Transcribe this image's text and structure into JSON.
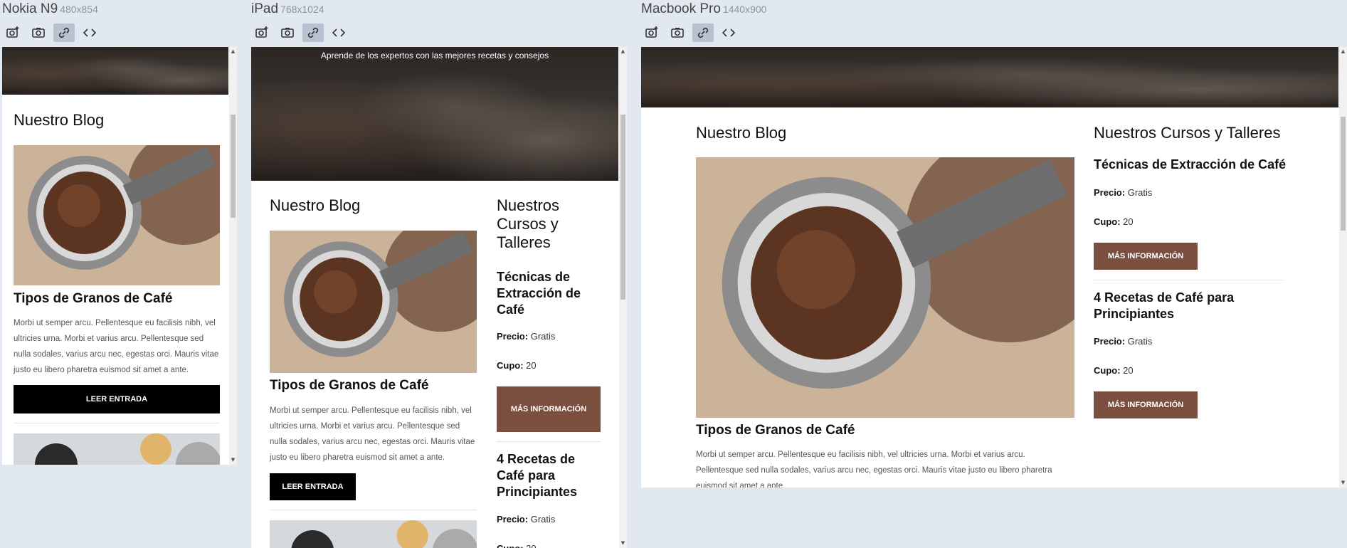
{
  "devices": [
    {
      "name": "Nokia N9",
      "size": "480x854"
    },
    {
      "name": "iPad",
      "size": "768x1024"
    },
    {
      "name": "Macbook Pro",
      "size": "1440x900"
    }
  ],
  "hero": {
    "tagline": "Aprende de los expertos con las mejores recetas y consejos"
  },
  "blog": {
    "heading": "Nuestro Blog",
    "post": {
      "title": "Tipos de Granos de Café",
      "excerpt": "Morbi ut semper arcu. Pellentesque eu facilisis nibh, vel ultricies urna. Morbi et varius arcu. Pellentesque sed nulla sodales, varius arcu nec, egestas orci. Mauris vitae justo eu libero pharetra euismod sit amet a ante.",
      "button": "Leer Entrada"
    }
  },
  "courses": {
    "heading": "Nuestros Cursos y Talleres",
    "price_label": "Precio:",
    "seats_label": "Cupo:",
    "items": [
      {
        "title": "Técnicas de Extracción de Café",
        "price": "Gratis",
        "seats": "20",
        "button": "Más Información"
      },
      {
        "title": "4 Recetas de Café para Principiantes",
        "price": "Gratis",
        "seats": "20",
        "button": "Más Información"
      }
    ]
  },
  "colors": {
    "brown": "#7a4f3f",
    "black": "#000000",
    "background": "#e1e8f0"
  },
  "icons": [
    "camera-plus-icon",
    "camera-icon",
    "link-icon",
    "code-icon"
  ]
}
